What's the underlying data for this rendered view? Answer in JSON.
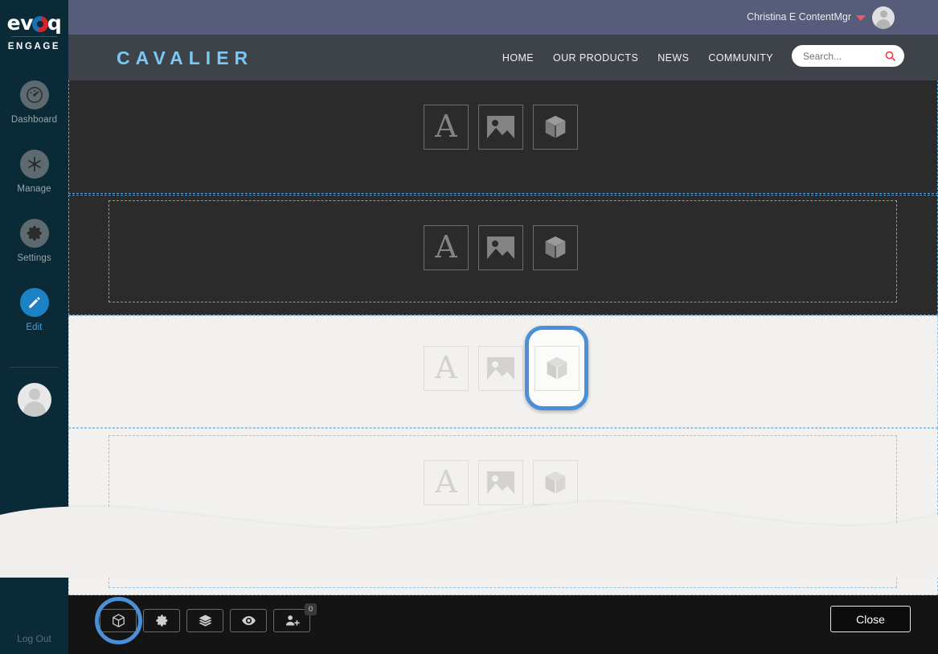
{
  "sidebar": {
    "brand": "evoq",
    "brand_sub": "ENGAGE",
    "items": [
      {
        "label": "Dashboard",
        "icon": "dashboard-gauge-icon",
        "active": false
      },
      {
        "label": "Manage",
        "icon": "manage-asterisk-icon",
        "active": false
      },
      {
        "label": "Settings",
        "icon": "gear-icon",
        "active": false
      },
      {
        "label": "Edit",
        "icon": "pencil-icon",
        "active": true
      }
    ],
    "logout_label": "Log Out",
    "avatar": "user-avatar-icon",
    "accent_active": "#1b82c6",
    "background": "#0a2a38"
  },
  "topbar": {
    "user_name": "Christina E ContentMgr",
    "caret": "chevron-down-icon",
    "caret_color": "#ef5b63",
    "avatar": "user-avatar-icon",
    "background": "#565c79"
  },
  "site_header": {
    "logo": "CAVALIER",
    "logo_color": "#79c9f2",
    "background": "#3e4349",
    "nav": [
      {
        "label": "HOME"
      },
      {
        "label": "OUR PRODUCTS"
      },
      {
        "label": "NEWS"
      },
      {
        "label": "COMMUNITY"
      }
    ],
    "search": {
      "placeholder": "Search...",
      "value": "",
      "icon": "search-magnifier-icon",
      "icon_color": "#ef3e46"
    }
  },
  "canvas": {
    "module_icons": [
      {
        "name": "text-module-icon",
        "glyph": "A"
      },
      {
        "name": "image-module-icon",
        "glyph": "image"
      },
      {
        "name": "generic-module-icon",
        "glyph": "cube"
      }
    ],
    "sections": [
      {
        "theme": "dark",
        "has_inner_pane": false
      },
      {
        "theme": "dark",
        "has_inner_pane": true
      },
      {
        "theme": "light",
        "has_inner_pane": false,
        "selected_module": "generic-module-icon"
      },
      {
        "theme": "light",
        "has_inner_pane": true
      }
    ],
    "selection_color": "#4a90d9",
    "dashed_border_color": "#5aa9dd"
  },
  "toolbar": {
    "buttons": [
      {
        "name": "modules-button",
        "icon": "cube-icon",
        "selected": true,
        "badge": null
      },
      {
        "name": "settings-button",
        "icon": "gear-icon",
        "selected": false,
        "badge": null
      },
      {
        "name": "layers-button",
        "icon": "layers-stack-icon",
        "selected": false,
        "badge": null
      },
      {
        "name": "preview-button",
        "icon": "eye-icon",
        "selected": false,
        "badge": null
      },
      {
        "name": "add-user-button",
        "icon": "user-plus-icon",
        "selected": false,
        "badge": "0"
      }
    ],
    "close_label": "Close",
    "background": "#141414"
  }
}
